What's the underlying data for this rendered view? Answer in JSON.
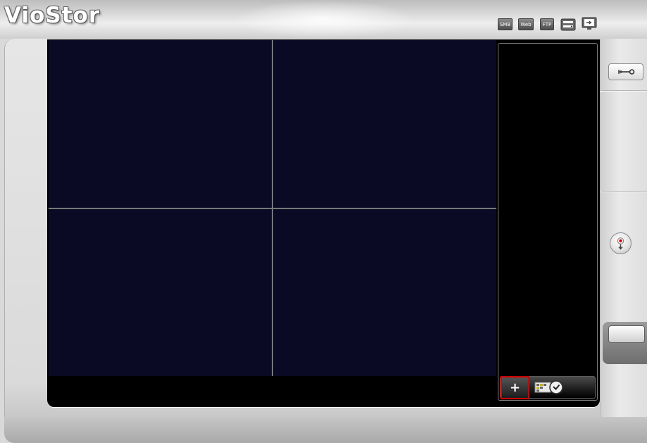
{
  "app": {
    "logo_text": "VioStor"
  },
  "top_icons": [
    {
      "name": "smb-icon",
      "label": "SMB"
    },
    {
      "name": "web-icon",
      "label": "Web"
    },
    {
      "name": "ftp-icon",
      "label": "FTP"
    },
    {
      "name": "network-device-icon",
      "label": ""
    },
    {
      "name": "monitor-export-icon",
      "label": ""
    }
  ],
  "live_view": {
    "layout": "2x2",
    "channels": [
      "",
      "",
      "",
      ""
    ]
  },
  "side_panel": {
    "add_label": "+",
    "schedule_icon": "schedule-grid-clock-icon"
  },
  "right_controls": {
    "settings_icon": "wrench-key-icon",
    "record_icon": "record-playback-icon"
  },
  "colors": {
    "video_background": "#0a0a24",
    "highlight": "#d10000"
  }
}
